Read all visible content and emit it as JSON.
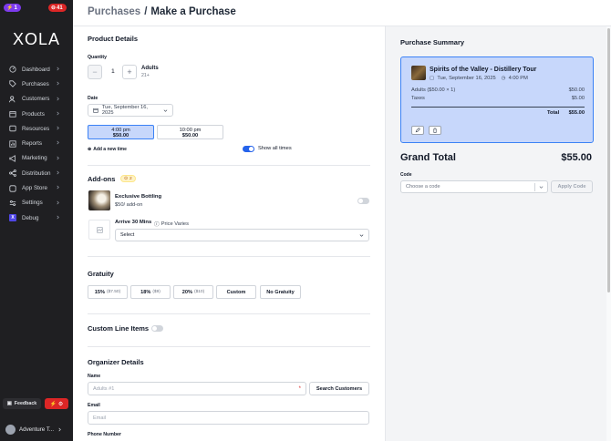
{
  "badges": {
    "left": "1",
    "right": "41"
  },
  "brand": {
    "logo": "XOLA"
  },
  "sidebar": {
    "items": [
      {
        "label": "Dashboard",
        "icon": "gauge-icon"
      },
      {
        "label": "Purchases",
        "icon": "tag-icon"
      },
      {
        "label": "Customers",
        "icon": "users-icon"
      },
      {
        "label": "Products",
        "icon": "calendar-icon"
      },
      {
        "label": "Resources",
        "icon": "box-icon"
      },
      {
        "label": "Reports",
        "icon": "chart-icon"
      },
      {
        "label": "Marketing",
        "icon": "megaphone-icon"
      },
      {
        "label": "Distribution",
        "icon": "network-icon"
      },
      {
        "label": "App Store",
        "icon": "store-icon"
      },
      {
        "label": "Settings",
        "icon": "sliders-icon"
      },
      {
        "label": "Debug",
        "icon": "debug-icon"
      }
    ],
    "feedback": "Feedback",
    "account": "Adventure T..."
  },
  "header": {
    "crumb": "Purchases",
    "separator": "/",
    "title": "Make a Purchase"
  },
  "product": {
    "title": "Product Details",
    "quantity_label": "Quantity",
    "quantity": "1",
    "adults_label": "Adults",
    "adults_sub": "21+",
    "date_label": "Date",
    "date_value": "Tue, September 16, 2025",
    "slots": [
      {
        "time": "4:00 pm",
        "price": "$50.00",
        "selected": true
      },
      {
        "time": "10:00 pm",
        "price": "$50.00",
        "selected": false
      }
    ],
    "add_time": "Add a new time",
    "show_all": "Show all times"
  },
  "addons": {
    "title": "Add-ons",
    "count": "2",
    "items": [
      {
        "name": "Exclusive Bottling",
        "sub": "$50/ add-on"
      },
      {
        "name": "Arrive 30 Mins",
        "sub": "Price Varies",
        "select": "Select"
      }
    ]
  },
  "gratuity": {
    "title": "Gratuity",
    "options": [
      {
        "label": "15%",
        "amount": "($7.50)"
      },
      {
        "label": "18%",
        "amount": "($9)"
      },
      {
        "label": "20%",
        "amount": "($10)"
      },
      {
        "label": "Custom",
        "amount": ""
      },
      {
        "label": "No Gratuity",
        "amount": ""
      }
    ]
  },
  "custom_lines": {
    "title": "Custom Line Items"
  },
  "organizer": {
    "title": "Organizer Details",
    "name_label": "Name",
    "name_placeholder": "Adults #1",
    "search_button": "Search Customers",
    "email_label": "Email",
    "email_placeholder": "Email",
    "phone_label": "Phone Number"
  },
  "summary": {
    "title": "Purchase Summary",
    "tour_title": "Spirits of the Valley - Distillery Tour",
    "tour_date": "Tue, September 16, 2025",
    "tour_time": "4:00 PM",
    "lines": [
      {
        "label": "Adults ($50.00 × 1)",
        "value": "$50.00"
      },
      {
        "label": "Taxes",
        "value": "$5.00"
      }
    ],
    "total_label": "Total",
    "total_value": "$55.00",
    "grand_label": "Grand Total",
    "grand_value": "$55.00",
    "code_label": "Code",
    "code_placeholder": "Choose a code",
    "apply": "Apply Code"
  },
  "colors": {
    "accent": "#2563eb",
    "selected_bg": "#c7d7fb",
    "sidebar_bg": "#1f1f22",
    "danger": "#dc2626"
  }
}
